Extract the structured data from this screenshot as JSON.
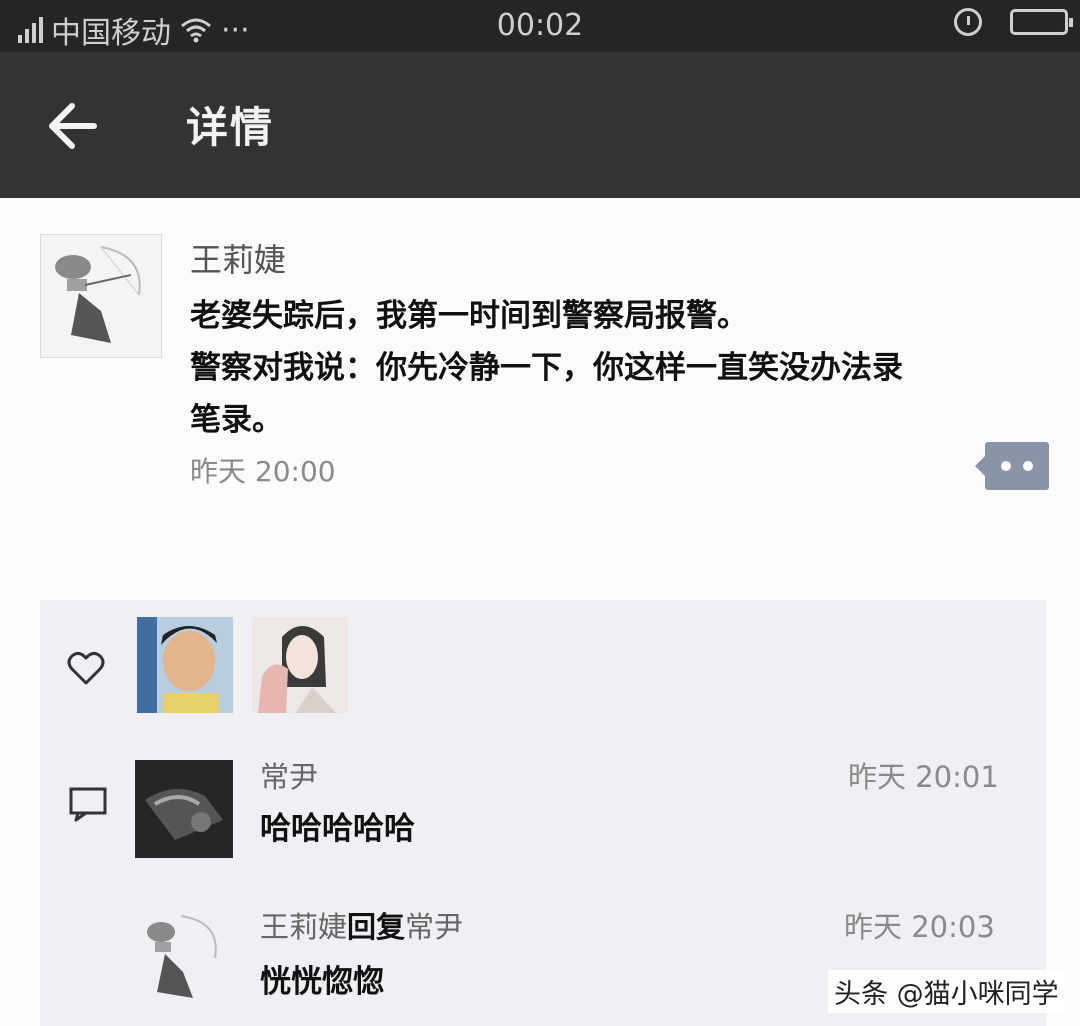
{
  "status_bar": {
    "carrier": "中国移动",
    "more": "···",
    "time": "00:02"
  },
  "title_bar": {
    "title": "详情"
  },
  "post": {
    "author": "王莉婕",
    "text_line1": "老婆失踪后，我第一时间到警察局报警。",
    "text_line2": "警察对我说：你先冷静一下，你这样一直笑没办法录",
    "text_line3": "笔录。",
    "time": "昨天 20:00"
  },
  "comments": [
    {
      "name": "常尹",
      "time": "昨天 20:01",
      "text": "哈哈哈哈哈"
    },
    {
      "name": "王莉婕",
      "reply_word": "回复",
      "reply_to": "常尹",
      "time": "昨天 20:03",
      "text": "恍恍惚惚"
    }
  ],
  "watermark": "头条 @猫小咪同学",
  "icons": {
    "back": "arrow-left-icon",
    "like": "heart-icon",
    "comment": "comment-icon",
    "more": "more-dots-icon",
    "alarm": "alarm-icon",
    "battery": "battery-icon",
    "wifi": "wifi-icon",
    "signal": "signal-icon"
  }
}
